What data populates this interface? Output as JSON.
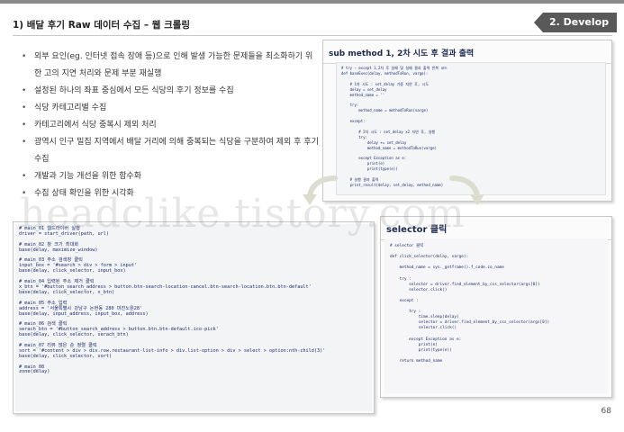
{
  "slide": {
    "title": "1) 배달 후기 Raw 데이터 수집 – 웹 크롤링",
    "tag": "2. Develop",
    "page_number": "68",
    "watermark": "headclike.tistory.com",
    "bullets": [
      "외부 요인(eg. 인터넷 접속 장애 등)으로 인해 발생 가능한 문제들을 최소화하기 위한 고의 지연 처리와 문제 부분 재실행",
      "설정된 하나의 좌표 중심에서 모든 식당의 후기 정보를 수집",
      "식당 카테고리별 수집",
      "카테고리에서 식당 중복시 제외 처리",
      "광역시 인구 밀집 지역에서 배달 거리에 의해 중복되는 식당을 구분하여 제외 후 후기 수집",
      "개발과 기능 개선을 위한 함수화",
      "수집 상태 확인을 위한 시각화"
    ]
  },
  "panels": {
    "submethod": {
      "title": "sub method 1, 2차 시도 후 결과 출력",
      "code": "# try - except 1,2차 후 실패 및 실패 결과 출력 반복 코드\ndef baseExec(delay, methodToRun, varge):\n\n    # 1차 시도 : set_delay 가중 지연 후, 시도\n    delay = set_delay\n    method_name = ''\n\n    try:\n        method_name = methodToRun(varge)\n\n    except:\n\n        # 2차 시도 : set_delay x2 지연 후, 실행\n        try:\n            delay += set_delay\n            method_name = methodToRun(varge)\n\n        except Exception as e:\n            print(e)\n            print(type(e))\n\n    # 실행 결과 출력\n    print_result(delay, set_delay, method_name)"
    },
    "main_code": {
      "code": "# main_01 웹드라이버 실행\ndriver = start_driver(path, url)\n\n# main_02 창 크기 최대화\nbase(delay, maximize_window)\n\n# main_03 주소 검색창 클릭\ninput_box = '#search > div > form > input'\nbase(delay, click_selector, input_box)\n\n# main_04 입력된 주소 제거 클릭\nx_btn = '#button_search_address > button.btn-search-location-cancel.btn-search-location.btn.btn-default'\nbase(delay, click_selector, x_btn)\n\n# main_05 주소 입력\naddress = '서울특별시 강남구 논현동 280 미진노원28'\nbase(delay, input_address, input_box, address)\n\n# main_06 검색 클릭\nserach_btn = '#button_search_address > button.btn.btn-default.ico-pick'\nbase(delay, click_selector, serach_btn)\n\n# main_07 리뷰 많은 순 정렬 클릭\nsort = '#content > div > div.row.restaurant-list-info > div.list-option > div > select > option:nth-child(3)'\nbase(delay, click_selector, sort)\n\n# main_08\nzone(delay)"
    },
    "selector": {
      "title": "selector 클릭",
      "code": "# selector 클릭\n\ndef click_selector(delay, varge):\n\n    method_name = sys._getframe().f_code.co_name\n\n    try :\n        selector = driver.find_element_by_css_selector(args[0])\n        selector.click()\n\n    except :\n\n        try :\n            time.sleep(delay)\n            selector = driver.find_element_by_css_selector(args[0])\n            selector.click()\n\n        except Exception as e:\n            print(e)\n            print(type(e))\n\n    return method_name"
    }
  },
  "icons": {
    "left_arrow": "curved-arrow-left-icon",
    "right_arrow": "curved-arrow-right-icon"
  },
  "colors": {
    "tag_bg": "#595959",
    "code_text": "#1a2c6b",
    "comment": "#7aa66e",
    "panel_title": "#1d2a50"
  }
}
